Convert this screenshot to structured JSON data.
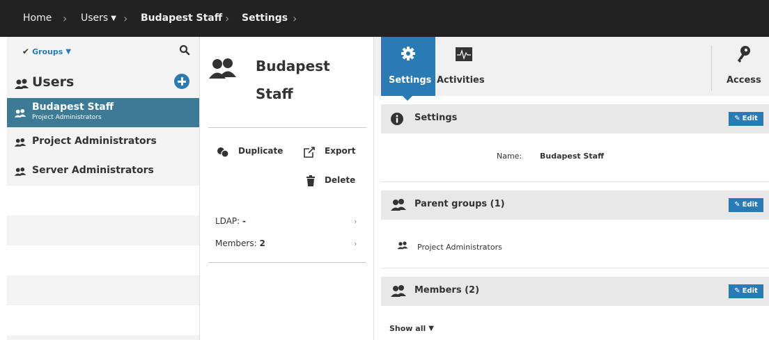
{
  "breadcrumb": {
    "home": "Home",
    "users": "Users",
    "group": "Budapest Staff",
    "page": "Settings"
  },
  "left": {
    "filter_label": "Groups",
    "title": "Users",
    "groups": [
      {
        "name": "Budapest Staff",
        "sub": "Project Administrators"
      },
      {
        "name": "Project Administrators"
      },
      {
        "name": "Server Administrators"
      }
    ]
  },
  "middle": {
    "title": "Budapest Staff",
    "actions": {
      "duplicate": "Duplicate",
      "export": "Export",
      "delete": "Delete"
    },
    "ldap_label": "LDAP:",
    "ldap_value": "-",
    "members_label": "Members:",
    "members_value": "2"
  },
  "right": {
    "tabs": {
      "settings": "Settings",
      "activities": "Activities",
      "access": "Access"
    },
    "settings_section": {
      "title": "Settings",
      "edit": "Edit",
      "name_label": "Name:",
      "name_value": "Budapest Staff"
    },
    "parents_section": {
      "title": "Parent groups (1)",
      "edit": "Edit",
      "items": [
        "Project Administrators"
      ]
    },
    "members_section": {
      "title": "Members  (2)",
      "edit": "Edit",
      "show_all": "Show all"
    }
  },
  "colors": {
    "accent": "#2a7ab3",
    "selected_row": "#3d7a96",
    "topbar": "#222222"
  }
}
